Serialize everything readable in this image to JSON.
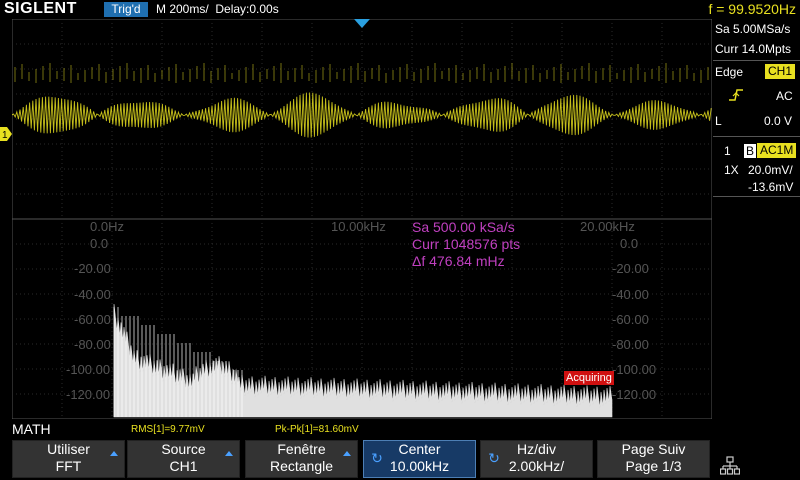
{
  "header": {
    "brand": "SIGLENT",
    "trigger_state": "Trig'd",
    "timebase": "M 200ms/  Delay:0.00s",
    "frequency": "f = 99.9520Hz"
  },
  "right_panel": {
    "sample_rate": "Sa 5.00MSa/s",
    "memory": "Curr 14.0Mpts",
    "trigger_type": "Edge",
    "trigger_source": "CH1",
    "coupling": "AC",
    "level_prefix": "L",
    "level": "0.0 V",
    "channel_num": "1",
    "bandwidth_flag": "B",
    "channel_coupling": "AC1M",
    "probe": "1X",
    "vdiv": "20.0mV/",
    "offset": "-13.6mV"
  },
  "fft": {
    "info_sa": "Sa 500.00 kSa/s",
    "info_curr": "Curr 1048576 pts",
    "info_df": "Δf 476.84 mHz",
    "hz_labels": [
      "0.0Hz",
      "10.00kHz",
      "20.00kHz"
    ],
    "db_left": [
      "0.0",
      "-20.00",
      "-40.00",
      "-60.00",
      "-80.00",
      "-100.00",
      "-120.00"
    ],
    "db_right": [
      "0.0",
      "-20.00",
      "-40.00",
      "-60.00",
      "-80.00",
      "-100.00",
      "-120.00"
    ],
    "acquiring": "Acquiring"
  },
  "status": {
    "math": "MATH",
    "rms": "RMS[1]=9.77mV",
    "pkpk": "Pk-Pk[1]=81.60mV"
  },
  "softkeys": [
    {
      "line1": "Utiliser",
      "line2": "FFT"
    },
    {
      "line1": "Source",
      "line2": "CH1"
    },
    {
      "line1": "Fenêtre",
      "line2": "Rectangle"
    },
    {
      "line1": "Center",
      "line2": "10.00kHz"
    },
    {
      "line1": "Hz/div",
      "line2": "2.00kHz/"
    },
    {
      "line1": "Page Suiv",
      "line2": "Page 1/3"
    }
  ],
  "colors": {
    "channel1": "#e8e020",
    "fft_trace": "#e0e0e0",
    "fft_info": "#c040c0",
    "accent": "#1f6fb0"
  },
  "icons": {
    "trigger_marker": "triangle-down-icon",
    "channel_marker": "ch1-offset-icon",
    "edge": "rising-edge-icon",
    "network": "network-icon"
  }
}
